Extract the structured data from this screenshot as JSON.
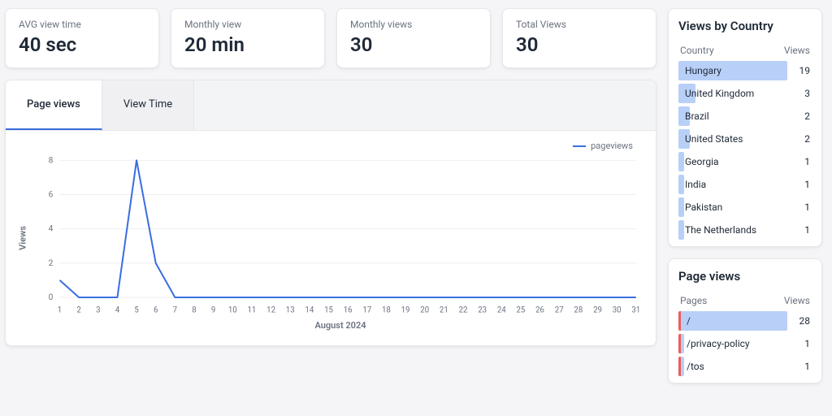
{
  "stats": [
    {
      "id": "avg-view-time",
      "label": "AVG view time",
      "value": "40 sec"
    },
    {
      "id": "monthly-view",
      "label": "Monthly view",
      "value": "20 min"
    },
    {
      "id": "monthly-views",
      "label": "Monthly views",
      "value": "30"
    },
    {
      "id": "total-views",
      "label": "Total Views",
      "value": "30"
    }
  ],
  "tabs": [
    {
      "id": "page-views",
      "label": "Page views",
      "active": true
    },
    {
      "id": "view-time",
      "label": "View Time",
      "active": false
    }
  ],
  "chart_data": {
    "type": "line",
    "title": "",
    "xlabel": "August 2024",
    "ylabel": "Views",
    "ylim": [
      0,
      8
    ],
    "yticks": [
      0,
      2,
      4,
      6,
      8
    ],
    "categories": [
      "1",
      "2",
      "3",
      "4",
      "5",
      "6",
      "7",
      "8",
      "9",
      "10",
      "11",
      "12",
      "13",
      "14",
      "15",
      "16",
      "17",
      "18",
      "19",
      "20",
      "21",
      "22",
      "23",
      "24",
      "25",
      "26",
      "27",
      "28",
      "29",
      "30",
      "31"
    ],
    "series": [
      {
        "name": "pageviews",
        "color": "#3b6fe0",
        "values": [
          1,
          0,
          0,
          0,
          8,
          2,
          0,
          0,
          0,
          0,
          0,
          0,
          0,
          0,
          0,
          0,
          0,
          0,
          0,
          0,
          0,
          0,
          0,
          0,
          0,
          0,
          0,
          0,
          0,
          0,
          0
        ]
      }
    ]
  },
  "legend_label": "pageviews",
  "views_by_country": {
    "title": "Views by Country",
    "header_col1": "Country",
    "header_col2": "Views",
    "max": 19,
    "rows": [
      {
        "label": "Hungary",
        "value": 19
      },
      {
        "label": "United Kingdom",
        "value": 3
      },
      {
        "label": "Brazil",
        "value": 2
      },
      {
        "label": "United States",
        "value": 2
      },
      {
        "label": "Georgia",
        "value": 1
      },
      {
        "label": "India",
        "value": 1
      },
      {
        "label": "Pakistan",
        "value": 1
      },
      {
        "label": "The Netherlands",
        "value": 1
      }
    ]
  },
  "page_views_card": {
    "title": "Page views",
    "header_col1": "Pages",
    "header_col2": "Views",
    "max": 28,
    "rows": [
      {
        "label": "/",
        "value": 28
      },
      {
        "label": "/privacy-policy",
        "value": 1
      },
      {
        "label": "/tos",
        "value": 1
      }
    ]
  }
}
